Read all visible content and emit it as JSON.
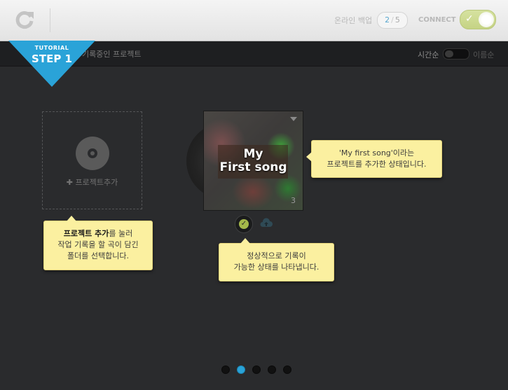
{
  "header": {
    "backup_label": "온라인 백업",
    "backup_current": "2",
    "backup_separator": "/",
    "backup_total": "5",
    "connect_label": "CONNECT",
    "connect_on": true
  },
  "subbar": {
    "title": "기록중인 프로젝트",
    "sort_label": "시간순",
    "sort_alt": "이름순"
  },
  "badge": {
    "small": "TUTORIAL",
    "big": "STEP 1",
    "color": "#2aa3d8"
  },
  "add_project": {
    "label": "✚ 프로젝트추가"
  },
  "project": {
    "title_line1": "My",
    "title_line2": "First song",
    "count": "3"
  },
  "tips": {
    "tip1_bold": "프로젝트 추가",
    "tip1_rest": "를 눌러",
    "tip1_line2": "작업 기록을 할 곡이 담긴",
    "tip1_line3": "폴더를 선택합니다.",
    "tip2_line1": "'My first song'이라는",
    "tip2_line2": "프로젝트를 추가한 상태입니다.",
    "tip3_line1": "정상적으로 기록이",
    "tip3_line2": "가능한 상태를 나타냅니다."
  },
  "pager": {
    "count": 5,
    "active_index": 1
  },
  "icons": {
    "refresh": "refresh-icon",
    "disc": "disc-icon",
    "check": "check-icon",
    "cloud": "cloud-upload-icon",
    "dropdown": "dropdown-arrow-icon"
  },
  "colors": {
    "accent": "#2aa3d8",
    "tooltip_bg": "#fbf0a0",
    "status_ok": "#a4b84a",
    "background": "#2a2b2d"
  }
}
